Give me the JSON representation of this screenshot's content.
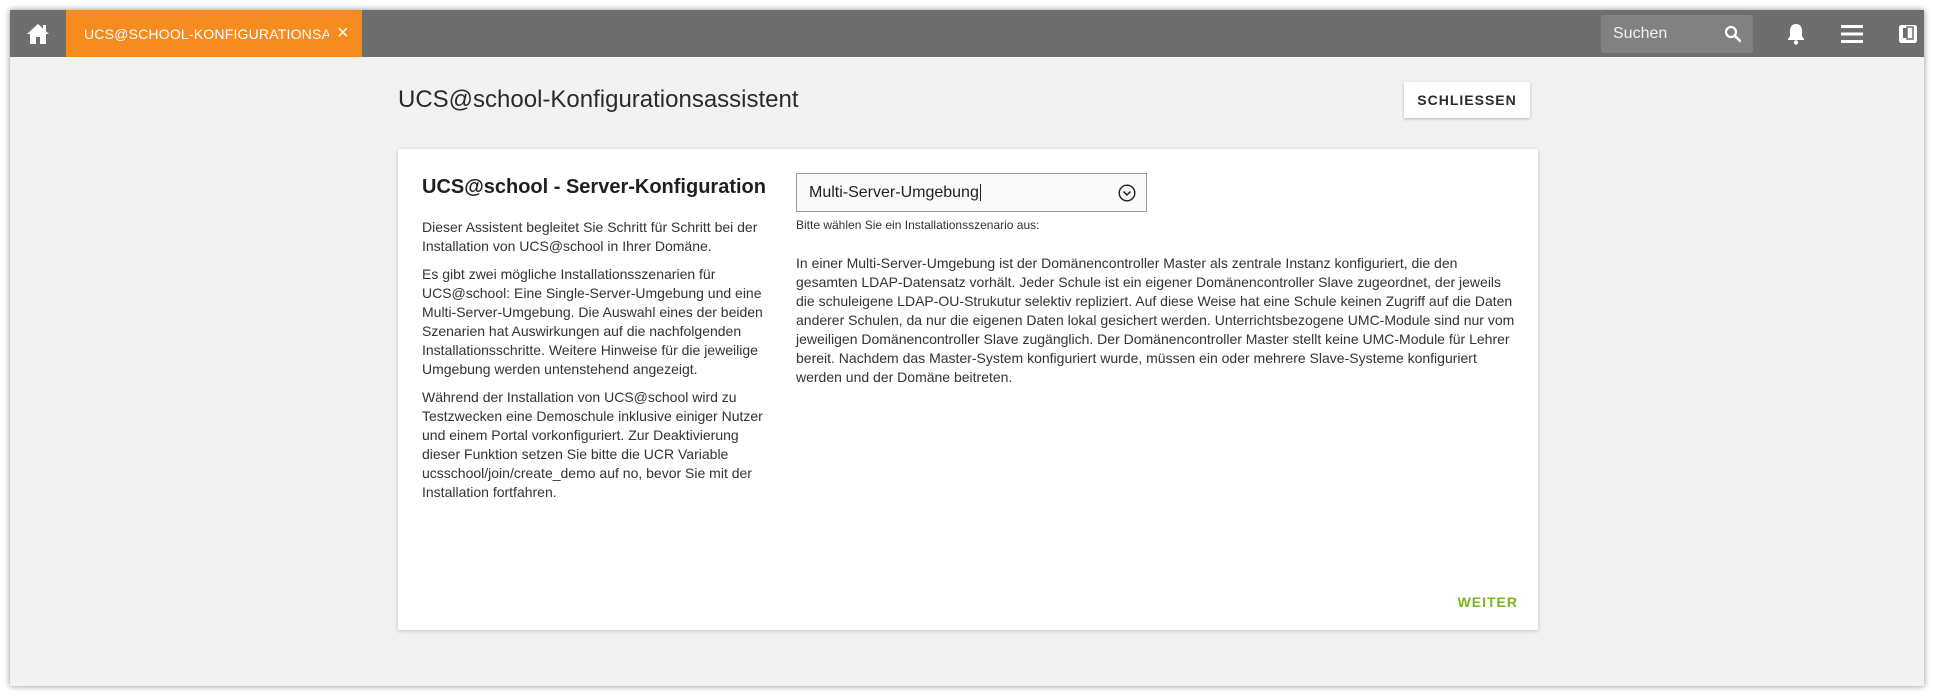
{
  "header": {
    "tab_label": "UCS@SCHOOL-KONFIGURATIONSAS…",
    "tab_close": "×",
    "search_placeholder": "Suchen",
    "colors": {
      "bar": "#6e6e6e",
      "tab": "#f68b1f"
    },
    "icons": [
      "home-icon",
      "search-icon",
      "bell-icon",
      "menu-icon",
      "tablet-icon"
    ]
  },
  "page": {
    "title": "UCS@school-Konfigurationsassistent",
    "close_label": "SCHLIESSEN"
  },
  "card": {
    "title": "UCS@school - Server-Konfiguration",
    "intro": [
      "Dieser Assistent begleitet Sie Schritt für Schritt bei der Installation von UCS@school in Ihrer Domäne.",
      "Es gibt zwei mögliche Installationsszenarien für UCS@school: Eine Single-Server-Umgebung und eine Multi-Server-Umgebung. Die Auswahl eines der beiden Szenarien hat Auswirkungen auf die nachfolgenden Installationsschritte. Weitere Hinweise für die jeweilige Umgebung werden untenstehend angezeigt.",
      "Während der Installation von UCS@school wird zu Testzwecken eine Demoschule inklusive einiger Nutzer und einem Portal vorkonfiguriert. Zur Deaktivierung dieser Funktion setzen Sie bitte die UCR Variable ucsschool/join/create_demo auf no, bevor Sie mit der Installation fortfahren."
    ],
    "scenario_select": {
      "value": "Multi-Server-Umgebung",
      "hint": "Bitte wählen Sie ein Installationsszenario aus:"
    },
    "scenario_description": "In einer Multi-Server-Umgebung ist der Domänencontroller Master als zentrale Instanz konfiguriert, die den gesamten LDAP-Datensatz vorhält. Jeder Schule ist ein eigener Domänencontroller Slave zugeordnet, der jeweils die schuleigene LDAP-OU-Strukutur selektiv repliziert. Auf diese Weise hat eine Schule keinen Zugriff auf die Daten anderer Schulen, da nur die eigenen Daten lokal gesichert werden. Unterrichtsbezogene UMC-Module sind nur vom jeweiligen Domänencontroller Slave zugänglich. Der Domänencontroller Master stellt keine UMC-Module für Lehrer bereit. Nachdem das Master-System konfiguriert wurde, müssen ein oder mehrere Slave-Systeme konfiguriert werden und der Domäne beitreten.",
    "next_label": "WEITER",
    "next_color": "#7ab51d"
  }
}
